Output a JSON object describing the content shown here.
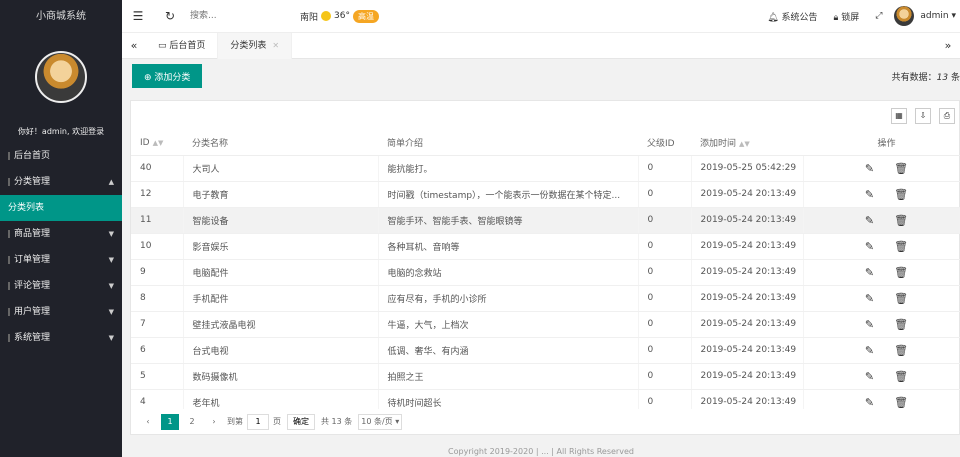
{
  "sidebar": {
    "brand": "小商城系统",
    "welcome": "你好！admin, 欢迎登录",
    "items": [
      {
        "label": "后台首页",
        "arrow": ""
      },
      {
        "label": "分类管理",
        "arrow": "▲"
      },
      {
        "label": "分类列表",
        "arrow": ""
      },
      {
        "label": "商品管理",
        "arrow": "▼"
      },
      {
        "label": "订单管理",
        "arrow": "▼"
      },
      {
        "label": "评论管理",
        "arrow": "▼"
      },
      {
        "label": "用户管理",
        "arrow": "▼"
      },
      {
        "label": "系统管理",
        "arrow": "▼"
      }
    ]
  },
  "header": {
    "search_placeholder": "搜索...",
    "city": "南阳",
    "temp": "36°",
    "aqi": "高温",
    "notice": "系统公告",
    "lock": "锁屏",
    "user": "admin"
  },
  "tabs": [
    {
      "label": "后台首页"
    },
    {
      "label": "分类列表"
    }
  ],
  "toolbar": {
    "add_label": "添加分类",
    "total_prefix": "共有数据：",
    "total_count": "13",
    "total_suffix": "条"
  },
  "table": {
    "headers": [
      "ID",
      "分类名称",
      "简单介绍",
      "父级ID",
      "添加时间",
      "操作"
    ],
    "rows": [
      [
        "40",
        "大司人",
        "能抗能打。",
        "0",
        "2019-05-25 05:42:29"
      ],
      [
        "12",
        "电子教育",
        "时间戳（timestamp），一个能表示一份数据在某个特定...",
        "0",
        "2019-05-24 20:13:49"
      ],
      [
        "11",
        "智能设备",
        "智能手环、智能手表、智能眼镜等",
        "0",
        "2019-05-24 20:13:49"
      ],
      [
        "10",
        "影音娱乐",
        "各种耳机、音响等",
        "0",
        "2019-05-24 20:13:49"
      ],
      [
        "9",
        "电脑配件",
        "电脑的念救站",
        "0",
        "2019-05-24 20:13:49"
      ],
      [
        "8",
        "手机配件",
        "应有尽有，手机的小诊所",
        "0",
        "2019-05-24 20:13:49"
      ],
      [
        "7",
        "壁挂式液晶电视",
        "牛逼，大气，上档次",
        "0",
        "2019-05-24 20:13:49"
      ],
      [
        "6",
        "台式电视",
        "低调、奢华、有内涵",
        "0",
        "2019-05-24 20:13:49"
      ],
      [
        "5",
        "数码摄像机",
        "拍照之王",
        "0",
        "2019-05-24 20:13:49"
      ],
      [
        "4",
        "老年机",
        "待机时间超长",
        "0",
        "2019-05-24 20:13:49"
      ]
    ]
  },
  "pager": {
    "pages": [
      "1",
      "2"
    ],
    "goto_label": "到第",
    "goto_value": "1",
    "page_unit": "页",
    "confirm": "确定",
    "total": "共 13 条",
    "per_page": "10 条/页"
  },
  "footer": "Copyright 2019-2020 | ... | All Rights Reserved"
}
